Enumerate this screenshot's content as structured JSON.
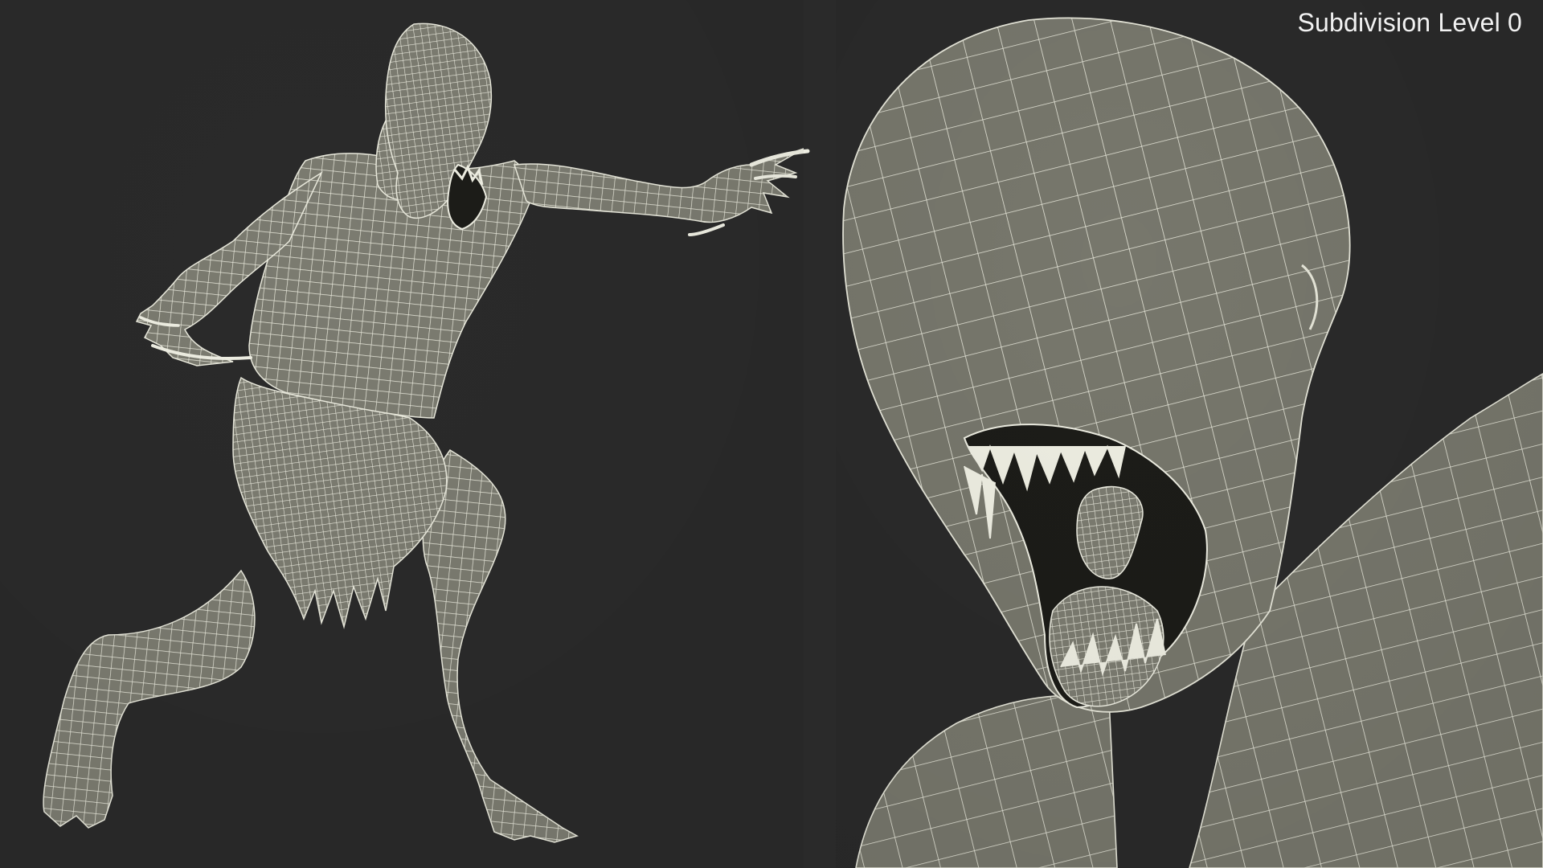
{
  "overlay": {
    "subdivision_label": "Subdivision Level 0"
  },
  "colors": {
    "background": "#2a2a2a",
    "mesh_fill": "#7b7b70",
    "mesh_fill_dark": "#5e5e55",
    "wire": "#e9e9dc",
    "teeth": "#eeeee2",
    "mouth_dark": "#1c1c18",
    "label": "#f2f2f2"
  },
  "views": [
    {
      "name": "full-body-view"
    },
    {
      "name": "head-closeup-view"
    }
  ]
}
